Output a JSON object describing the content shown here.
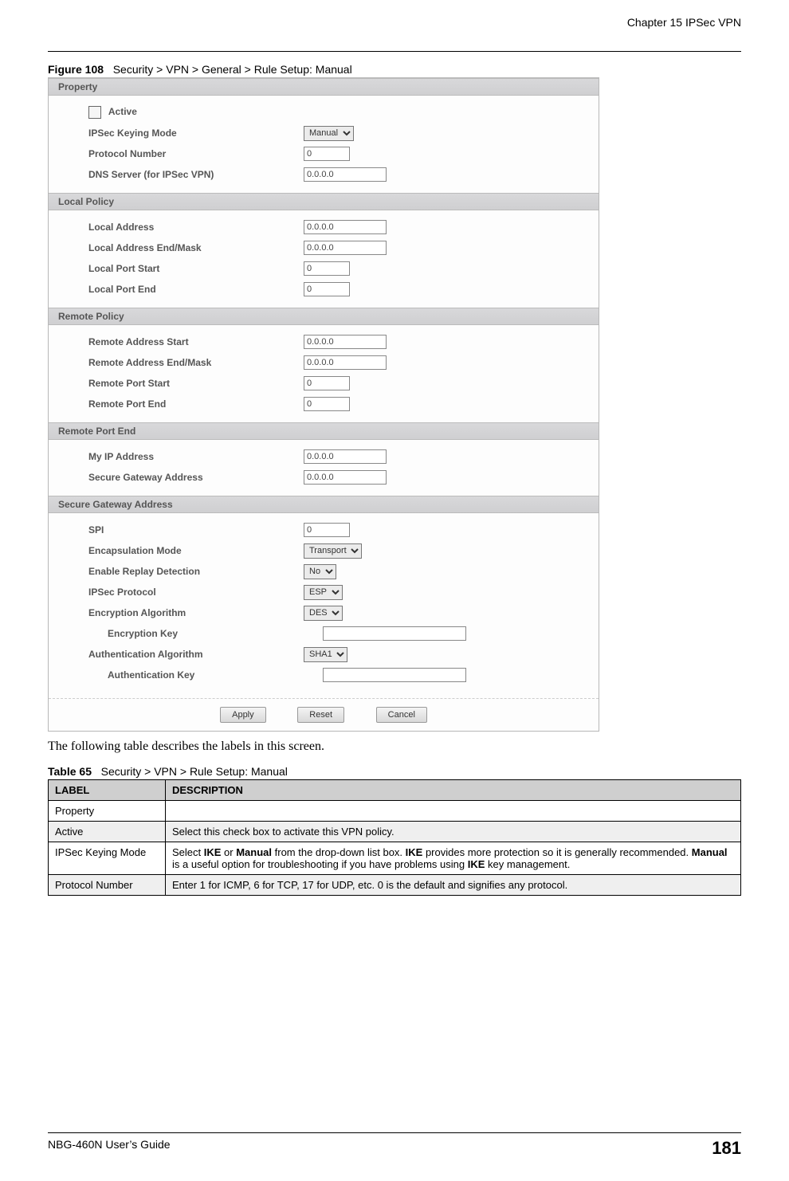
{
  "header": {
    "chapter": "Chapter 15 IPSec VPN"
  },
  "figure": {
    "label": "Figure 108",
    "title": "Security > VPN > General > Rule Setup: Manual"
  },
  "screenshot": {
    "sections": {
      "property": {
        "title": "Property",
        "fields": {
          "active_label": "Active",
          "ipsec_mode_label": "IPSec Keying Mode",
          "ipsec_mode_value": "Manual",
          "protocol_label": "Protocol Number",
          "protocol_value": "0",
          "dns_label": "DNS Server (for IPSec VPN)",
          "dns_value": "0.0.0.0"
        }
      },
      "local_policy": {
        "title": "Local Policy",
        "fields": {
          "addr_label": "Local Address",
          "addr_value": "0.0.0.0",
          "endmask_label": "Local Address End/Mask",
          "endmask_value": "0.0.0.0",
          "port_start_label": "Local Port Start",
          "port_start_value": "0",
          "port_end_label": "Local Port End",
          "port_end_value": "0"
        }
      },
      "remote_policy": {
        "title": "Remote Policy",
        "fields": {
          "addr_label": "Remote Address Start",
          "addr_value": "0.0.0.0",
          "endmask_label": "Remote Address End/Mask",
          "endmask_value": "0.0.0.0",
          "port_start_label": "Remote Port Start",
          "port_start_value": "0",
          "port_end_label": "Remote Port End",
          "port_end_value": "0"
        }
      },
      "remote_port_end": {
        "title": "Remote Port End",
        "fields": {
          "myip_label": "My IP Address",
          "myip_value": "0.0.0.0",
          "gw_label": "Secure Gateway Address",
          "gw_value": "0.0.0.0"
        }
      },
      "secure_gateway": {
        "title": "Secure Gateway Address",
        "fields": {
          "spi_label": "SPI",
          "spi_value": "0",
          "encap_label": "Encapsulation Mode",
          "encap_value": "Transport",
          "replay_label": "Enable Replay Detection",
          "replay_value": "No",
          "proto_label": "IPSec Protocol",
          "proto_value": "ESP",
          "encalg_label": "Encryption Algorithm",
          "encalg_value": "DES",
          "enckey_label": "Encryption Key",
          "enckey_value": "",
          "authalg_label": "Authentication Algorithm",
          "authalg_value": "SHA1",
          "authkey_label": "Authentication Key",
          "authkey_value": ""
        }
      }
    },
    "buttons": {
      "apply": "Apply",
      "reset": "Reset",
      "cancel": "Cancel"
    }
  },
  "intro_text": "The following table describes the labels in this screen.",
  "table": {
    "label": "Table 65",
    "title": "Security > VPN > Rule Setup: Manual",
    "head_label": "LABEL",
    "head_desc": "DESCRIPTION",
    "rows": [
      {
        "label": "Property",
        "desc": ""
      },
      {
        "label": "Active",
        "desc": "Select this check box to activate this VPN policy."
      },
      {
        "label": "IPSec Keying Mode",
        "desc_html": "Select <b>IKE</b> or <b>Manual</b> from the drop-down list box. <b>IKE</b> provides more protection so it is generally recommended. <b>Manual</b> is a useful option for troubleshooting if you have problems using <b>IKE</b> key management."
      },
      {
        "label": "Protocol Number",
        "desc": "Enter 1 for ICMP, 6 for TCP, 17 for UDP, etc. 0 is the default and signifies any protocol."
      }
    ]
  },
  "footer": {
    "guide": "NBG-460N User’s Guide",
    "page": "181"
  }
}
